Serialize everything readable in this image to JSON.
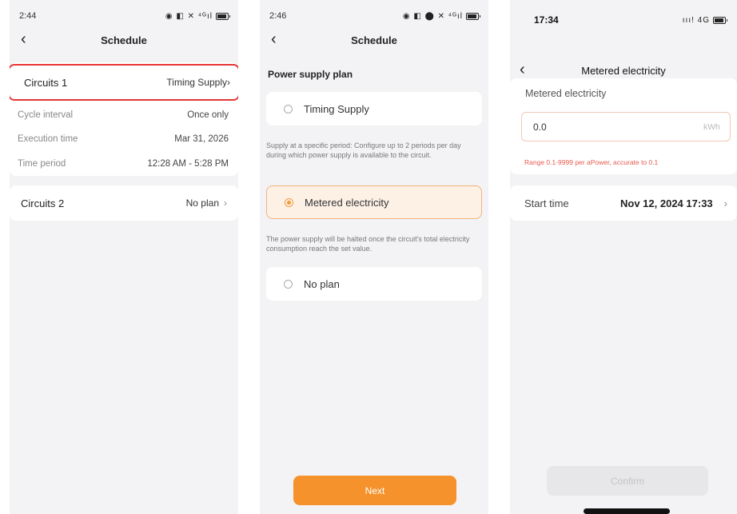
{
  "screen1": {
    "status_time": "2:44",
    "status_icons": "◉ ◧ ✕ ⁴ᴳıl",
    "title": "Schedule",
    "circuit1": {
      "name": "Circuits 1",
      "value": "Timing Supply",
      "details": [
        {
          "label": "Cycle interval",
          "value": "Once only"
        },
        {
          "label": "Execution time",
          "value": "Mar 31, 2026"
        },
        {
          "label": "Time period",
          "value": "12:28 AM - 5:28 PM"
        }
      ]
    },
    "circuit2": {
      "name": "Circuits 2",
      "value": "No plan"
    },
    "highlight_color": "#e53535"
  },
  "screen2": {
    "status_time": "2:46",
    "status_icons": "◉ ◧ ⬤ ✕ ⁴ᴳıl",
    "title": "Schedule",
    "section_title": "Power supply plan",
    "options": [
      {
        "label": "Timing Supply",
        "selected": false
      },
      {
        "label": "Metered electricity",
        "selected": true
      },
      {
        "label": "No plan",
        "selected": false
      }
    ],
    "desc_timing": "Supply at a specific period: Configure up to 2 periods per day during which power supply is available to the circuit.",
    "desc_metered": "The power supply will be halted once the circuit's total electricity consumption reach the set value.",
    "next_label": "Next",
    "accent_color": "#f5922c"
  },
  "screen3": {
    "status_time": "17:34",
    "status_icons": "ııı! 4G",
    "title": "Metered electricity",
    "field_label": "Metered electricity",
    "input_value": "0.0",
    "unit": "kWh",
    "hint": "Range 0.1-9999 per aPower, accurate to 0.1",
    "start_label": "Start time",
    "start_value": "Nov 12, 2024 17:33",
    "confirm_label": "Confirm"
  },
  "icons": {
    "back": "back-chevron-icon",
    "forward": "chevron-right-icon"
  }
}
